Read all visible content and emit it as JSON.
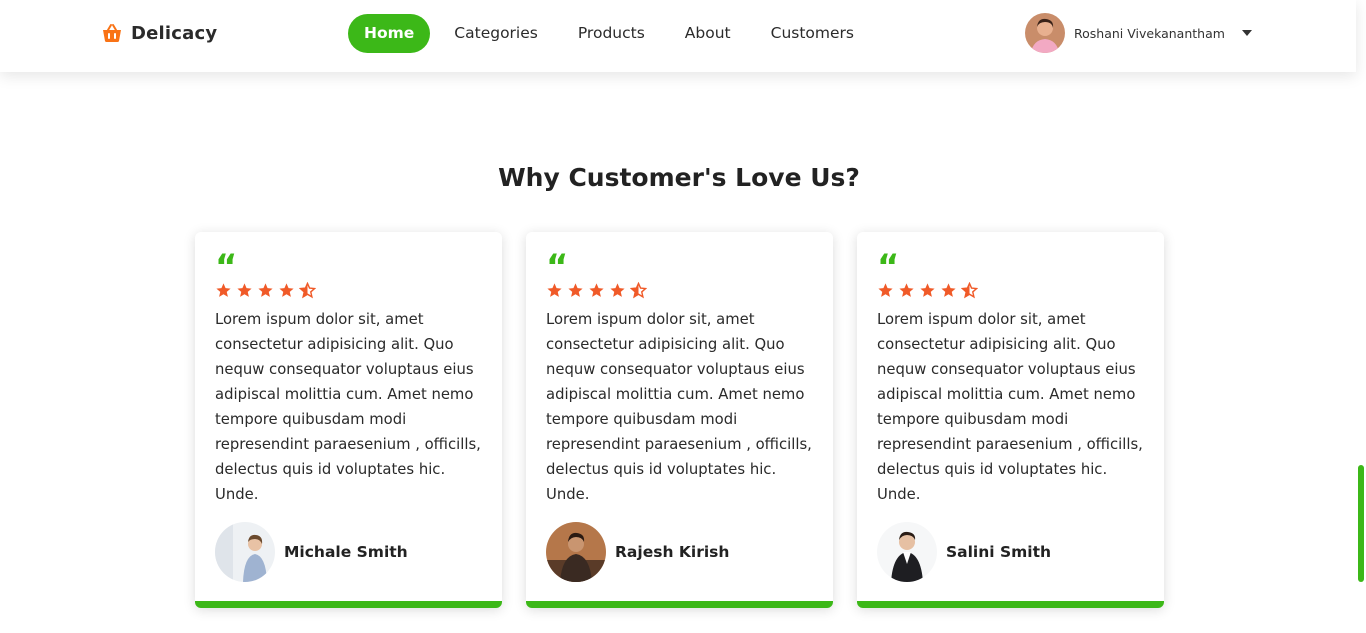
{
  "brand": {
    "name": "Delicacy",
    "icon": "basket-icon",
    "icon_color": "#f97316"
  },
  "nav": {
    "items": [
      {
        "label": "Home",
        "active": true
      },
      {
        "label": "Categories",
        "active": false
      },
      {
        "label": "Products",
        "active": false
      },
      {
        "label": "About",
        "active": false
      },
      {
        "label": "Customers",
        "active": false
      }
    ]
  },
  "user": {
    "name": "Roshani Vivekanantham",
    "menu_icon": "caret-down-icon"
  },
  "section": {
    "title": "Why Customer's Love Us?"
  },
  "testimonials": [
    {
      "rating": 4.5,
      "text": "Lorem ispum dolor sit, amet consectetur adipisicing alit. Quo nequw consequator voluptaus eius adipiscal molittia cum. Amet nemo tempore quibusdam modi represendint paraesenium , officills, delectus quis id voluptates hic. Unde.",
      "author": "Michale Smith"
    },
    {
      "rating": 4.5,
      "text": "Lorem ispum dolor sit, amet consectetur adipisicing alit. Quo nequw consequator voluptaus eius adipiscal molittia cum. Amet nemo tempore quibusdam modi represendint paraesenium , officills, delectus quis id voluptates hic. Unde.",
      "author": "Rajesh Kirish"
    },
    {
      "rating": 4.5,
      "text": "Lorem ispum dolor sit, amet consectetur adipisicing alit. Quo nequw consequator voluptaus eius adipiscal molittia cum. Amet nemo tempore quibusdam modi represendint paraesenium , officills, delectus quis id voluptates hic. Unde.",
      "author": "Salini Smith"
    }
  ],
  "colors": {
    "accent": "#3cb818",
    "star": "#f05a28",
    "brand_icon": "#f97316"
  },
  "scroll": {
    "position_fraction": 0.74
  }
}
